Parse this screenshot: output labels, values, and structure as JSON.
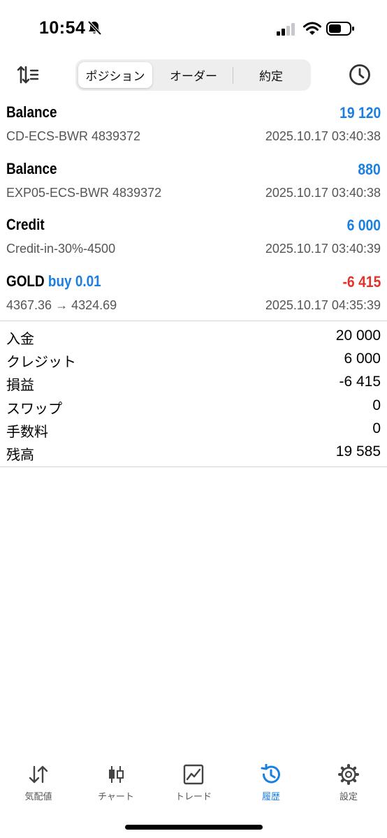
{
  "status_bar": {
    "time": "10:54"
  },
  "toolbar": {
    "segments": [
      "ポジション",
      "オーダー",
      "約定"
    ],
    "active_segment": 0
  },
  "deals": [
    {
      "title": "Balance",
      "amount": "19 120",
      "comment": "CD-ECS-BWR 4839372",
      "time": "2025.10.17 03:40:38"
    },
    {
      "title": "Balance",
      "amount": "880",
      "comment": "EXP05-ECS-BWR 4839372",
      "time": "2025.10.17 03:40:38"
    },
    {
      "title": "Credit",
      "amount": "6 000",
      "comment": "Credit-in-30%-4500",
      "time": "2025.10.17 03:40:39"
    },
    {
      "title": "GOLD",
      "side": "buy 0.01",
      "amount": "-6 415",
      "comment": "4367.36 → 4324.69",
      "time": "2025.10.17 04:35:39"
    }
  ],
  "summary": [
    {
      "label": "入金",
      "value": "20 000"
    },
    {
      "label": "クレジット",
      "value": "6 000"
    },
    {
      "label": "損益",
      "value": "-6 415"
    },
    {
      "label": "スワップ",
      "value": "0"
    },
    {
      "label": "手数料",
      "value": "0"
    },
    {
      "label": "残高",
      "value": "19 585"
    }
  ],
  "tabbar": {
    "items": [
      {
        "label": "気配値",
        "icon": "quotes-arrows-icon"
      },
      {
        "label": "チャート",
        "icon": "candlestick-chart-icon"
      },
      {
        "label": "トレード",
        "icon": "trade-chart-icon"
      },
      {
        "label": "履歴",
        "icon": "history-icon"
      },
      {
        "label": "設定",
        "icon": "gear-icon"
      }
    ],
    "active": 3
  },
  "colors": {
    "accent": "#1a7fe0",
    "loss": "#e0342b"
  }
}
